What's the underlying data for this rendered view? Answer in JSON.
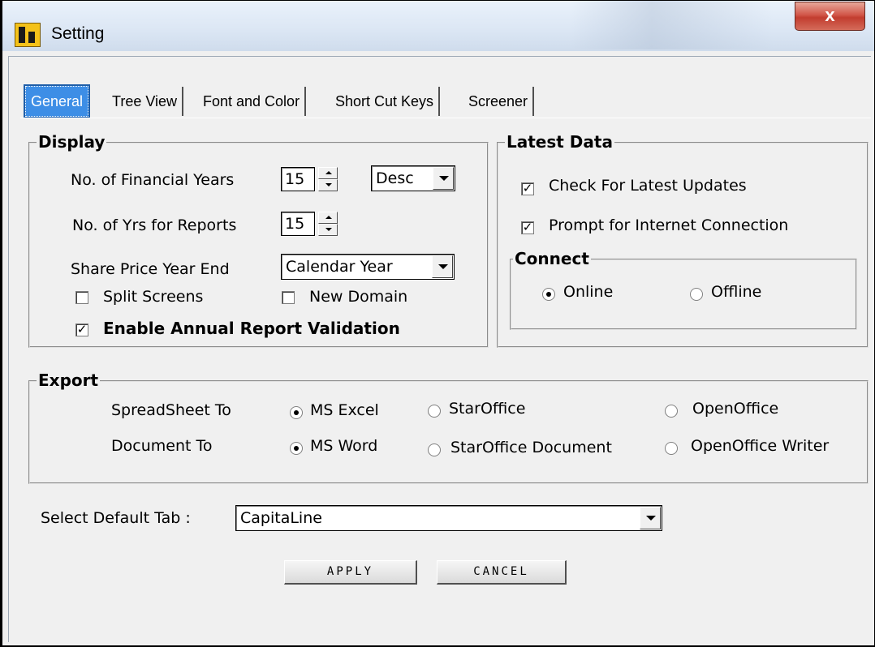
{
  "window": {
    "title": "Setting",
    "close_label": "x"
  },
  "tabs": [
    {
      "label": "General",
      "active": true
    },
    {
      "label": "Tree View",
      "active": false
    },
    {
      "label": "Font and Color",
      "active": false
    },
    {
      "label": "Short Cut Keys",
      "active": false
    },
    {
      "label": "Screener",
      "active": false
    }
  ],
  "display": {
    "legend": "Display",
    "financial_years_label": "No. of Financial Years",
    "financial_years_value": "15",
    "order_value": "Desc",
    "report_years_label": "No. of Yrs for Reports",
    "report_years_value": "15",
    "share_price_label": "Share Price Year End",
    "share_price_value": "Calendar Year",
    "split_screens_label": "Split Screens",
    "split_screens_checked": false,
    "new_domain_label": "New Domain",
    "new_domain_checked": false,
    "annual_validation_label": "Enable Annual Report Validation",
    "annual_validation_checked": true,
    "check_mark": "✓"
  },
  "latest_data": {
    "legend": "Latest Data",
    "check_updates_label": "Check For Latest Updates",
    "check_updates_checked": true,
    "prompt_internet_label": "Prompt for Internet Connection",
    "prompt_internet_checked": true,
    "connect_legend": "Connect",
    "online_label": "Online",
    "offline_label": "Offline",
    "selected": "Online"
  },
  "export": {
    "legend": "Export",
    "spreadsheet_label": "SpreadSheet To",
    "spreadsheet_options": [
      "MS Excel",
      "StarOffice",
      "OpenOffice"
    ],
    "spreadsheet_selected": "MS Excel",
    "document_label": "Document To",
    "document_options": [
      "MS Word",
      "StarOffice Document",
      "OpenOffice Writer"
    ],
    "document_selected": "MS Word"
  },
  "default_tab": {
    "label": "Select Default Tab :",
    "value": "CapitaLine"
  },
  "buttons": {
    "apply_label": "APPLY",
    "cancel_label": "CANCEL"
  },
  "colors": {
    "active_tab": "#3d8ee6",
    "close_button": "#c9473a"
  }
}
